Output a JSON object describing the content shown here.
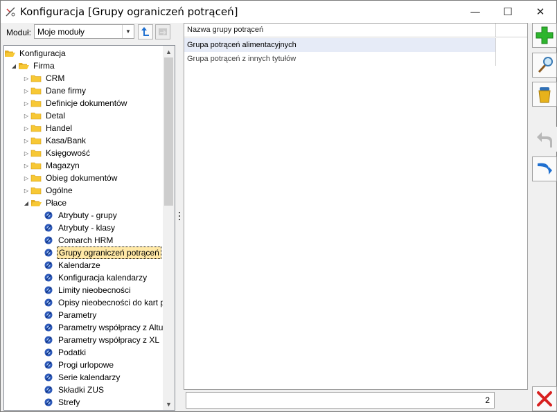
{
  "window": {
    "title": "Konfiguracja [Grupy ograniczeń potrąceń]",
    "minimize_glyph": "—",
    "maximize_glyph": "☐",
    "close_glyph": "✕"
  },
  "module": {
    "label": "Moduł:",
    "selected": "Moje moduły"
  },
  "tree": {
    "items": [
      {
        "label": "Konfiguracja",
        "level": 0,
        "icon": "folder-open-icon",
        "expander": ""
      },
      {
        "label": "Firma",
        "level": 1,
        "icon": "folder-open-icon",
        "expander": "◢"
      },
      {
        "label": "CRM",
        "level": 2,
        "icon": "folder-icon",
        "expander": "▷"
      },
      {
        "label": "Dane firmy",
        "level": 2,
        "icon": "folder-icon",
        "expander": "▷"
      },
      {
        "label": "Definicje dokumentów",
        "level": 2,
        "icon": "folder-icon",
        "expander": "▷"
      },
      {
        "label": "Detal",
        "level": 2,
        "icon": "folder-icon",
        "expander": "▷"
      },
      {
        "label": "Handel",
        "level": 2,
        "icon": "folder-icon",
        "expander": "▷"
      },
      {
        "label": "Kasa/Bank",
        "level": 2,
        "icon": "folder-icon",
        "expander": "▷"
      },
      {
        "label": "Księgowość",
        "level": 2,
        "icon": "folder-icon",
        "expander": "▷"
      },
      {
        "label": "Magazyn",
        "level": 2,
        "icon": "folder-icon",
        "expander": "▷"
      },
      {
        "label": "Obieg dokumentów",
        "level": 2,
        "icon": "folder-icon",
        "expander": "▷"
      },
      {
        "label": "Ogólne",
        "level": 2,
        "icon": "folder-icon",
        "expander": "▷"
      },
      {
        "label": "Płace",
        "level": 2,
        "icon": "folder-open-icon",
        "expander": "◢"
      },
      {
        "label": "Atrybuty - grupy",
        "level": 3,
        "icon": "settings-leaf-icon",
        "expander": ""
      },
      {
        "label": "Atrybuty - klasy",
        "level": 3,
        "icon": "settings-leaf-icon",
        "expander": ""
      },
      {
        "label": "Comarch HRM",
        "level": 3,
        "icon": "settings-leaf-icon",
        "expander": ""
      },
      {
        "label": "Grupy ograniczeń potrąceń",
        "level": 3,
        "icon": "settings-leaf-icon",
        "expander": "",
        "selected": true
      },
      {
        "label": "Kalendarze",
        "level": 3,
        "icon": "settings-leaf-icon",
        "expander": ""
      },
      {
        "label": "Konfiguracja kalendarzy",
        "level": 3,
        "icon": "settings-leaf-icon",
        "expander": ""
      },
      {
        "label": "Limity nieobecności",
        "level": 3,
        "icon": "settings-leaf-icon",
        "expander": ""
      },
      {
        "label": "Opisy nieobecności do kart p...",
        "level": 3,
        "icon": "settings-leaf-icon",
        "expander": ""
      },
      {
        "label": "Parametry",
        "level": 3,
        "icon": "settings-leaf-icon",
        "expander": ""
      },
      {
        "label": "Parametry współpracy z Altum",
        "level": 3,
        "icon": "settings-leaf-icon",
        "expander": ""
      },
      {
        "label": "Parametry współpracy z XL",
        "level": 3,
        "icon": "settings-leaf-icon",
        "expander": ""
      },
      {
        "label": "Podatki",
        "level": 3,
        "icon": "settings-leaf-icon",
        "expander": ""
      },
      {
        "label": "Progi urlopowe",
        "level": 3,
        "icon": "settings-leaf-icon",
        "expander": ""
      },
      {
        "label": "Serie kalendarzy",
        "level": 3,
        "icon": "settings-leaf-icon",
        "expander": ""
      },
      {
        "label": "Składki ZUS",
        "level": 3,
        "icon": "settings-leaf-icon",
        "expander": ""
      },
      {
        "label": "Strefy",
        "level": 3,
        "icon": "settings-leaf-icon",
        "expander": ""
      }
    ]
  },
  "grid": {
    "column_header": "Nazwa grupy potrąceń",
    "rows": [
      "Grupa potrąceń alimentacyjnych",
      "Grupa potrąceń z innych tytułów"
    ],
    "record_count": "2"
  },
  "toolbar_icons": {
    "add": "plus-icon",
    "edit": "magnifier-icon",
    "delete": "trash-icon",
    "back": "undo-icon",
    "forward": "redo-icon",
    "close": "close-x-icon"
  },
  "colors": {
    "selected_row": "#e6ebf7",
    "selected_tree_item": "#ffe8a6",
    "folder_yellow": "#f7c835",
    "add_green": "#2db52d",
    "close_red": "#d8201f",
    "nav_blue": "#1e6fd0"
  }
}
